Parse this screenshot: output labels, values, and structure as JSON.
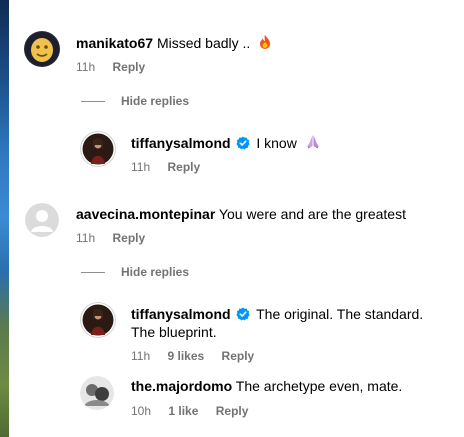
{
  "comments": [
    {
      "username": "manikato67",
      "text": "Missed badly ..",
      "emoji": "fire-emoji",
      "time": "11h",
      "reply_label": "Reply",
      "hide_replies_label": "Hide replies",
      "replies": [
        {
          "username": "tiffanysalmond",
          "verified": true,
          "text": "I know",
          "emoji": "praying-hands-emoji",
          "time": "11h",
          "reply_label": "Reply"
        }
      ]
    },
    {
      "username": "aavecina.montepinar",
      "text": "You were and are the greatest",
      "time": "11h",
      "reply_label": "Reply",
      "hide_replies_label": "Hide replies",
      "replies": [
        {
          "username": "tiffanysalmond",
          "verified": true,
          "text": "The original. The standard. The blueprint.",
          "time": "11h",
          "likes": "9 likes",
          "reply_label": "Reply"
        },
        {
          "username": "the.majordomo",
          "text": "The archetype even, mate.",
          "time": "10h",
          "likes": "1 like",
          "reply_label": "Reply"
        }
      ]
    }
  ],
  "colors": {
    "verified_blue": "#0095f6",
    "meta_gray": "#737373"
  }
}
